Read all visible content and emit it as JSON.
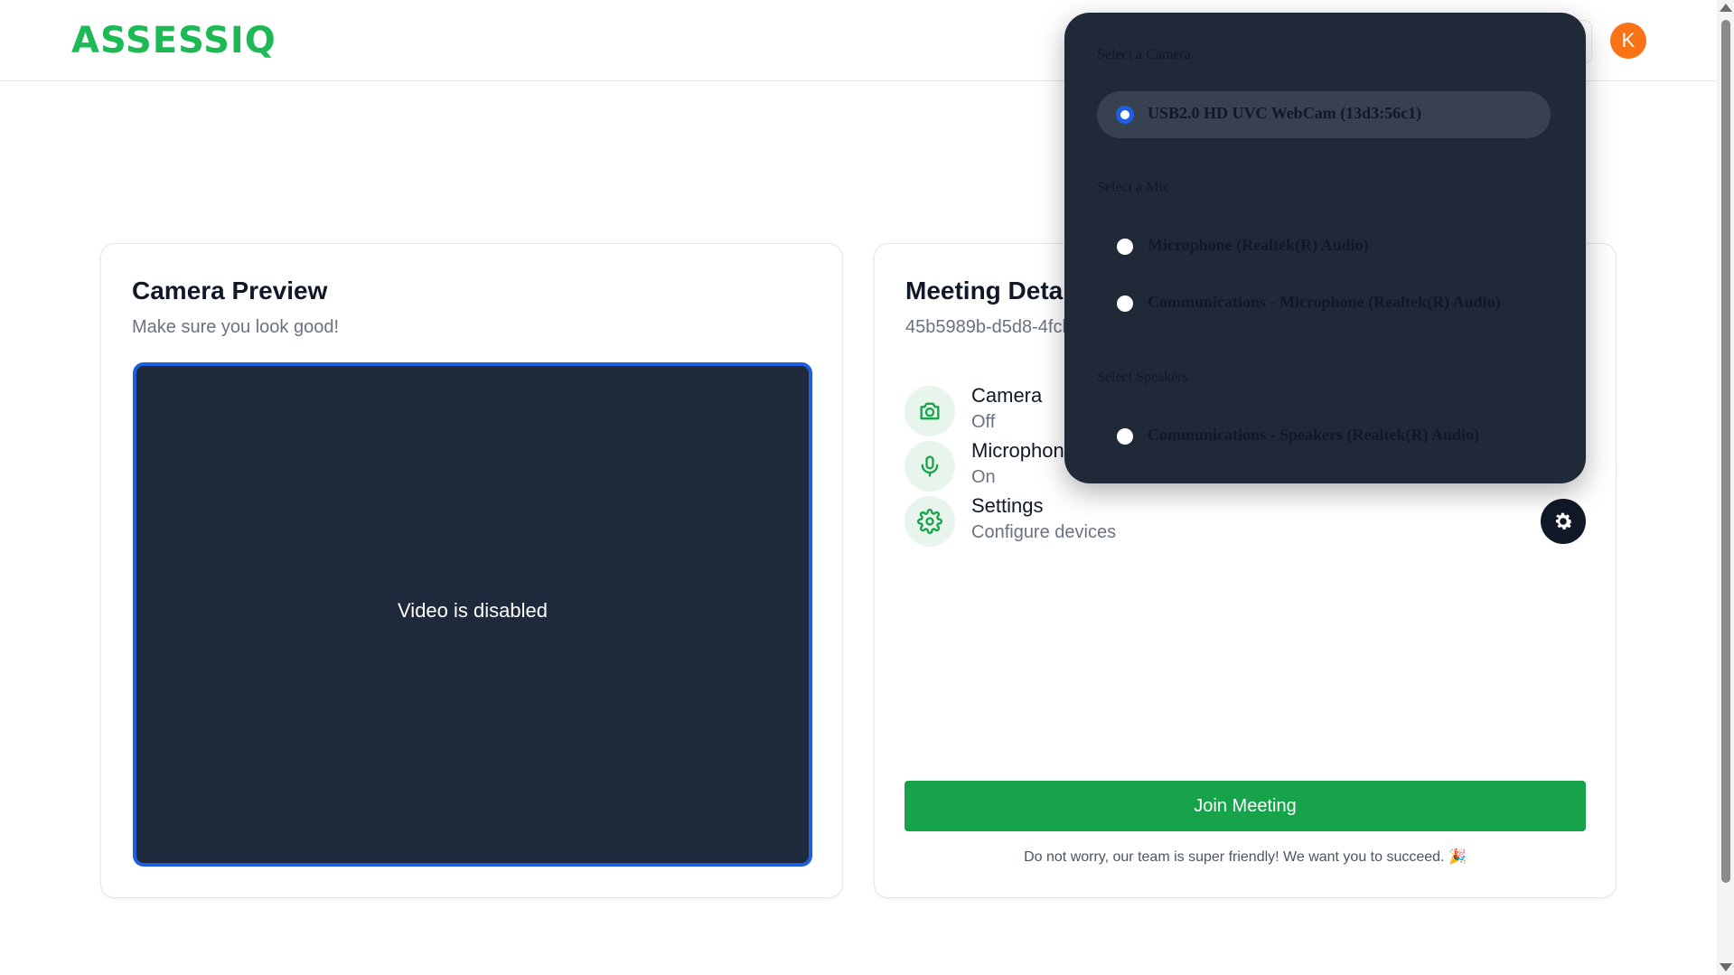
{
  "header": {
    "logo_text": "ASSESSIQ",
    "avatar_initial": "K"
  },
  "camera_preview": {
    "title": "Camera Preview",
    "subtitle": "Make sure you look good!",
    "video_status": "Video is disabled"
  },
  "meeting_details": {
    "title": "Meeting Details",
    "meeting_id": "45b5989b-d5d8-4fcb",
    "devices": [
      {
        "label": "Camera",
        "value": "Off",
        "icon": "camera-icon"
      },
      {
        "label": "Microphone",
        "value": "On",
        "icon": "microphone-icon"
      },
      {
        "label": "Settings",
        "value": "Configure devices",
        "icon": "gear-icon"
      }
    ],
    "join_label": "Join Meeting",
    "footer_note": "Do not worry, our team is super friendly! We want you to succeed. 🎉"
  },
  "device_dropdown": {
    "camera_heading": "Select a Camera",
    "cameras": [
      {
        "label": "USB2.0 HD UVC WebCam (13d3:56c1)",
        "selected": true
      }
    ],
    "mic_heading": "Select a Mic",
    "mics": [
      {
        "label": "Microphone (Realtek(R) Audio)",
        "selected": false
      },
      {
        "label": "Communications - Microphone (Realtek(R) Audio)",
        "selected": false
      }
    ],
    "speaker_heading": "Select Speakers",
    "speakers": [
      {
        "label": "Communications - Speakers (Realtek(R) Audio)",
        "selected": false
      }
    ]
  },
  "colors": {
    "brand_green": "#1db954",
    "join_button": "#16a34a",
    "avatar": "#f97316",
    "video_bg": "#1e293b",
    "video_border": "#1d5fe0",
    "dropdown_bg": "#1f2937"
  }
}
